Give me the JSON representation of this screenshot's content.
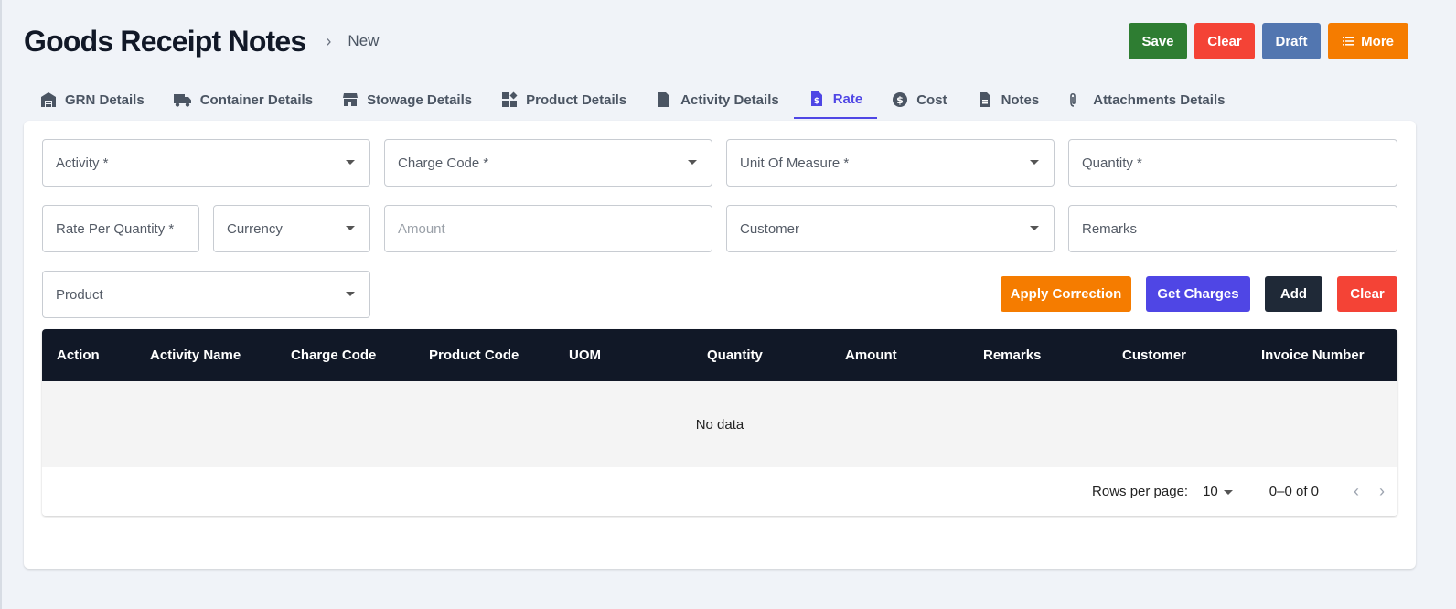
{
  "header": {
    "title": "Goods Receipt Notes",
    "separator": "›",
    "crumb": "New",
    "buttons": {
      "save": "Save",
      "clear": "Clear",
      "draft": "Draft",
      "more": "More"
    }
  },
  "tabs": [
    {
      "label": "GRN Details",
      "icon": "warehouse-icon"
    },
    {
      "label": "Container Details",
      "icon": "truck-icon"
    },
    {
      "label": "Stowage Details",
      "icon": "store-icon"
    },
    {
      "label": "Product Details",
      "icon": "widgets-icon"
    },
    {
      "label": "Activity Details",
      "icon": "file-chart-icon"
    },
    {
      "label": "Rate",
      "icon": "dollar-file-icon",
      "active": true
    },
    {
      "label": "Cost",
      "icon": "dollar-circle-icon"
    },
    {
      "label": "Notes",
      "icon": "document-icon"
    },
    {
      "label": "Attachments Details",
      "icon": "paperclip-icon"
    }
  ],
  "form": {
    "activity": "Activity *",
    "charge_code": "Charge Code *",
    "uom": "Unit Of Measure *",
    "quantity": "Quantity *",
    "rate_per_quantity": "Rate Per Quantity *",
    "currency": "Currency",
    "amount": "Amount",
    "customer": "Customer",
    "remarks": "Remarks",
    "product": "Product"
  },
  "form_buttons": {
    "apply_correction": "Apply Correction",
    "get_charges": "Get Charges",
    "add": "Add",
    "clear": "Clear"
  },
  "table": {
    "columns": [
      "Action",
      "Activity Name",
      "Charge Code",
      "Product Code",
      "UOM",
      "Quantity",
      "Amount",
      "Remarks",
      "Customer",
      "Invoice Number"
    ],
    "empty_text": "No data",
    "rows_per_page_label": "Rows per page:",
    "rows_per_page": "10",
    "range": "0–0 of 0"
  },
  "colors": {
    "accent": "#4f46e5",
    "save": "#2e7d32",
    "clear": "#f44336",
    "draft": "#5276b0",
    "more": "#f57c00",
    "table_header": "#111827"
  }
}
